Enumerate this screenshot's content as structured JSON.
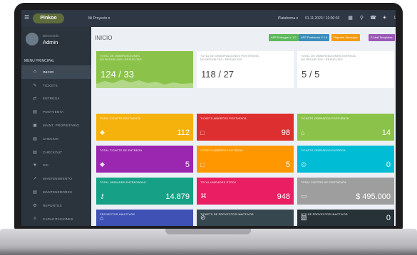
{
  "topbar": {
    "logo_text": "Pinkoo",
    "project_selector": "Mi Proyecto ▾",
    "language": "Plataforma ▾",
    "date": "01.11.2023 / 10:00:03"
  },
  "user": {
    "role": "Bienvenido",
    "name": "Admin"
  },
  "sidebar": {
    "heading": "MENU PRINCIPAL",
    "items": [
      {
        "label": "INICIO",
        "icon": "home-icon",
        "glyph": "⌂"
      },
      {
        "label": "TICKETS",
        "icon": "ticket-icon",
        "glyph": "✎"
      },
      {
        "label": "ENTREGA",
        "icon": "truck-icon",
        "glyph": "⇄"
      },
      {
        "label": "POSTVENTA",
        "icon": "file-icon",
        "glyph": "▤"
      },
      {
        "label": "MAINT. PROPIETARIO",
        "icon": "user-icon",
        "glyph": "▣"
      },
      {
        "label": "CHECKIN",
        "icon": "checkin-icon",
        "glyph": "▤"
      },
      {
        "label": "CHECKOUT",
        "icon": "checkout-icon",
        "glyph": "▤"
      },
      {
        "label": "SIC",
        "icon": "book-icon",
        "glyph": "▼"
      },
      {
        "label": "MANTENIMIENTO",
        "icon": "wrench-icon",
        "glyph": "↗"
      },
      {
        "label": "MANTENEDORES",
        "icon": "database-icon",
        "glyph": "▤"
      },
      {
        "label": "REPORTES",
        "icon": "gear-icon",
        "glyph": "⚙"
      },
      {
        "label": "CAPACITACIONES",
        "icon": "list-icon",
        "glyph": "≡"
      },
      {
        "label": "CONFIGURACIÓN",
        "icon": "settings-icon",
        "glyph": "⚙"
      }
    ]
  },
  "main": {
    "page_title": "INICIO",
    "actions": [
      {
        "label": "APP Entregas V 1.0",
        "color": "#5cb85c"
      },
      {
        "label": "APP Postventa V 1.0",
        "color": "#3c8dbc"
      },
      {
        "label": "Reportar Mensajes",
        "color": "#f39c12"
      },
      {
        "label": "E-Mail Templates",
        "color": "#9b59b6"
      }
    ],
    "summary": [
      {
        "label": "TOTAL DE OBSERVACIONES\nNO RESUELTAS / RESUELTAS",
        "value": "124 / 33",
        "note": "",
        "color": "#8bc34a"
      },
      {
        "label": "TOTAL DE OBSERVACIONES POSTVENTA\nNO RESUELTAS / RESUELTAS",
        "value": "118 / 27",
        "note": "",
        "color": "#ffffff"
      },
      {
        "label": "TOTAL DE OBSERVACIONES ENTREGA\nNO RESUELTAS / RESUELTAS",
        "value": "5 / 5",
        "note": "",
        "color": "#ffffff"
      }
    ],
    "rows": [
      [
        {
          "label": "TOTAL TICKETS POSTVENTA",
          "value": "112",
          "icon": "tag-icon",
          "glyph": "◆",
          "color": "#f5b20c"
        },
        {
          "label": "TICKETS ABIERTOS POSTVENTA",
          "value": "98",
          "icon": "tablet-icon",
          "glyph": "□",
          "color": "#dd2f2f"
        },
        {
          "label": "TICKETS CERRADOS POSTVENTA",
          "value": "14",
          "icon": "lock-icon",
          "glyph": "⌂",
          "color": "#8bc34a"
        }
      ],
      [
        {
          "label": "TOTAL TICKETS DE ENTREGA",
          "value": "5",
          "icon": "tag-icon",
          "glyph": "◆",
          "color": "#9b27b0"
        },
        {
          "label": "TICKETS ABIERTOS ENTREGA",
          "value": "5",
          "icon": "tablet-icon",
          "glyph": "□",
          "color": "#ff9800"
        },
        {
          "label": "TICKETS CERRADOS ENTREGA",
          "value": "0",
          "icon": "bank-icon",
          "glyph": "◎",
          "color": "#00bcd4"
        }
      ],
      [
        {
          "label": "TOTAL UNIDADES ENTREGADAS",
          "value": "14.879",
          "icon": "key-icon",
          "glyph": "⚷",
          "color": "#16a085"
        },
        {
          "label": "TOTAL UNIDADES STOCK",
          "value": "948",
          "icon": "cubes-icon",
          "glyph": "⌘",
          "color": "#e91e63"
        },
        {
          "label": "TOTAL COSTOS DE POSTVENTA",
          "value": "$ 495.000",
          "icon": "money-icon",
          "glyph": "▭",
          "color": "#9e9e9e"
        }
      ],
      [
        {
          "label": "PROYECTOS INACTIVOS",
          "value": "",
          "icon": "lock-icon",
          "glyph": "⌂",
          "color": "#3f51b5"
        },
        {
          "label": "TICKETS DE PROYECTOS INACTIVOS",
          "value": "",
          "icon": "block-icon",
          "glyph": "⊘",
          "color": "#37474f"
        },
        {
          "label": "OTS DE PROYECTOS INACTIVOS",
          "value": "0",
          "icon": "copy-icon",
          "glyph": "▧",
          "color": "#263238"
        }
      ]
    ]
  },
  "topbar_icons": [
    "grid-icon",
    "search-icon",
    "phone-icon",
    "bell-icon",
    "power-icon"
  ]
}
